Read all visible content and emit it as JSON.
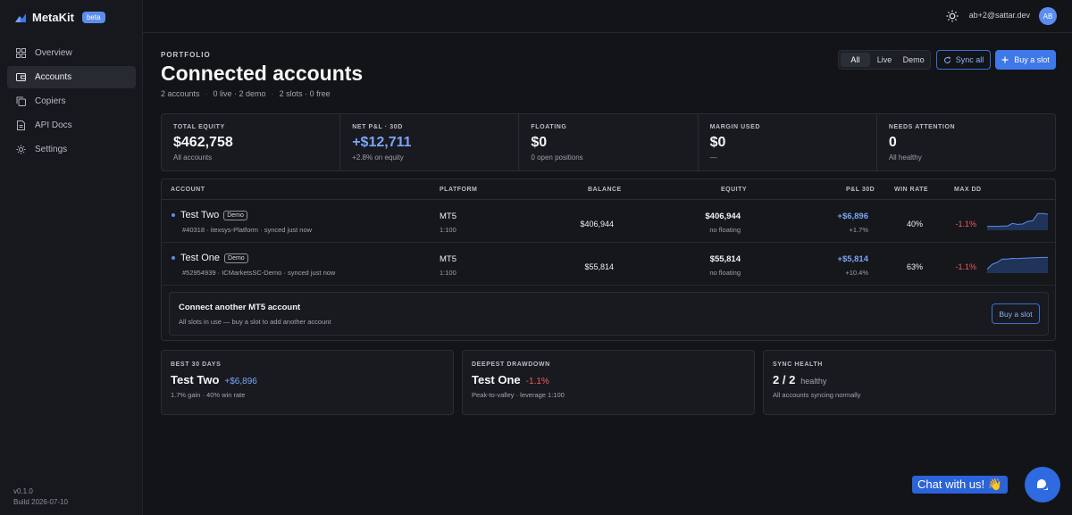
{
  "app": {
    "name": "MetaKit",
    "badge": "beta",
    "version": "v0.1.0",
    "build": "Build 2026-07-10"
  },
  "nav": [
    {
      "label": "Overview",
      "icon": "grid-icon"
    },
    {
      "label": "Accounts",
      "icon": "wallet-icon",
      "active": true
    },
    {
      "label": "Copiers",
      "icon": "copy-icon"
    },
    {
      "label": "API Docs",
      "icon": "document-icon"
    },
    {
      "label": "Settings",
      "icon": "gear-icon"
    }
  ],
  "topbar": {
    "email": "ab+2@sattar.dev",
    "avatar": "AB"
  },
  "header": {
    "eyebrow": "PORTFOLIO",
    "title": "Connected accounts",
    "sub": [
      "2 accounts",
      "0 live · 2 demo",
      "2 slots · 0 free"
    ]
  },
  "filters": [
    "All",
    "Live",
    "Demo"
  ],
  "actions": {
    "sync": "Sync all",
    "buy": "Buy a slot"
  },
  "stats": [
    {
      "label": "TOTAL EQUITY",
      "value": "$462,758",
      "sub": "All accounts"
    },
    {
      "label": "NET P&L · 30D",
      "value": "+$12,711",
      "sub": "+2.8% on equity"
    },
    {
      "label": "FLOATING",
      "value": "$0",
      "sub": "0 open positions"
    },
    {
      "label": "MARGIN USED",
      "value": "$0",
      "sub": "—"
    },
    {
      "label": "NEEDS ATTENTION",
      "value": "0",
      "sub": "All healthy"
    }
  ],
  "table": {
    "columns": [
      "ACCOUNT",
      "PLATFORM",
      "BALANCE",
      "EQUITY",
      "P&L 30D",
      "WIN RATE",
      "MAX DD"
    ],
    "rows": [
      {
        "name": "Test Two",
        "badge": "Demo",
        "meta": "#40318 · itexsys-Platform · synced just now",
        "platform": "MT5",
        "leverage": "1:100",
        "balance": "$406,944",
        "equity": "$406,944",
        "floating": "no floating",
        "pnl": "+$6,896",
        "pnl_pct": "+1.7%",
        "win_rate": "40%",
        "max_dd": "-1.1%",
        "spark": [
          0.2,
          0.2,
          0.2,
          0.22,
          0.22,
          0.35,
          0.3,
          0.32,
          0.45,
          0.48,
          0.85,
          0.85,
          0.82
        ]
      },
      {
        "name": "Test One",
        "badge": "Demo",
        "meta": "#52954939 · ICMarketsSC-Demo · synced just now",
        "platform": "MT5",
        "leverage": "1:100",
        "balance": "$55,814",
        "equity": "$55,814",
        "floating": "no floating",
        "pnl": "+$5,814",
        "pnl_pct": "+10.4%",
        "win_rate": "63%",
        "max_dd": "-1.1%",
        "spark": [
          0.2,
          0.45,
          0.55,
          0.72,
          0.72,
          0.75,
          0.74,
          0.76,
          0.77,
          0.78,
          0.79,
          0.8,
          0.8
        ]
      }
    ]
  },
  "connect": {
    "title": "Connect another MT5 account",
    "sub": "All slots in use — buy a slot to add another account",
    "button": "Buy a slot"
  },
  "cards": {
    "best": {
      "label": "BEST 30 DAYS",
      "name": "Test Two",
      "value": "+$6,896",
      "sub": "1.7% gain · 40% win rate"
    },
    "drawdown": {
      "label": "DEEPEST DRAWDOWN",
      "name": "Test One",
      "value": "-1.1%",
      "sub": "Peak-to-valley · leverage 1:100"
    },
    "health": {
      "label": "SYNC HEALTH",
      "value": "2 / 2",
      "status": "healthy",
      "sub": "All accounts syncing normally"
    }
  },
  "chat": {
    "label": "Chat with us! 👋"
  },
  "colors": {
    "accent": "#3f78e8",
    "positive": "#7ba4f4",
    "negative": "#ef5b5b",
    "background": "#121418"
  }
}
